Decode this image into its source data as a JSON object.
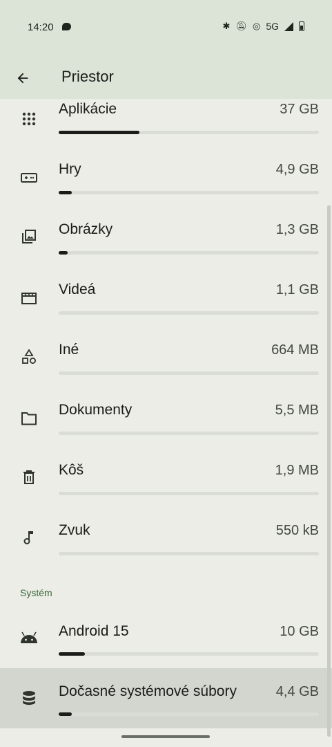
{
  "status": {
    "time": "14:20",
    "network": "5G"
  },
  "appbar": {
    "title": "Priestor"
  },
  "items": [
    {
      "label": "Aplikácie",
      "size": "37 GB",
      "icon": "apps-grid-icon",
      "fill": 0.31
    },
    {
      "label": "Hry",
      "size": "4,9 GB",
      "icon": "gamepad-icon",
      "fill": 0.05
    },
    {
      "label": "Obrázky",
      "size": "1,3 GB",
      "icon": "image-icon",
      "fill": 0.03
    },
    {
      "label": "Videá",
      "size": "1,1 GB",
      "icon": "movie-icon",
      "fill": 0.0
    },
    {
      "label": "Iné",
      "size": "664 MB",
      "icon": "shapes-icon",
      "fill": 0.0
    },
    {
      "label": "Dokumenty",
      "size": "5,5 MB",
      "icon": "folder-icon",
      "fill": 0.0
    },
    {
      "label": "Kôš",
      "size": "1,9 MB",
      "icon": "trash-icon",
      "fill": 0.0
    },
    {
      "label": "Zvuk",
      "size": "550 kB",
      "icon": "music-note-icon",
      "fill": 0.0
    }
  ],
  "system_section": {
    "header": "Systém",
    "items": [
      {
        "label": "Android 15",
        "size": "10 GB",
        "icon": "android-icon",
        "fill": 0.1
      },
      {
        "label": "Dočasné systémové súbory",
        "size": "4,4 GB",
        "icon": "database-icon",
        "fill": 0.05
      }
    ]
  },
  "colors": {
    "background": "#EBEDE6",
    "appbar": "#DCE4D8",
    "selected_row": "#D2D6CF",
    "bar_track": "#DADDD5",
    "bar_fill": "#1b1c19",
    "section_header": "#3c6839"
  }
}
